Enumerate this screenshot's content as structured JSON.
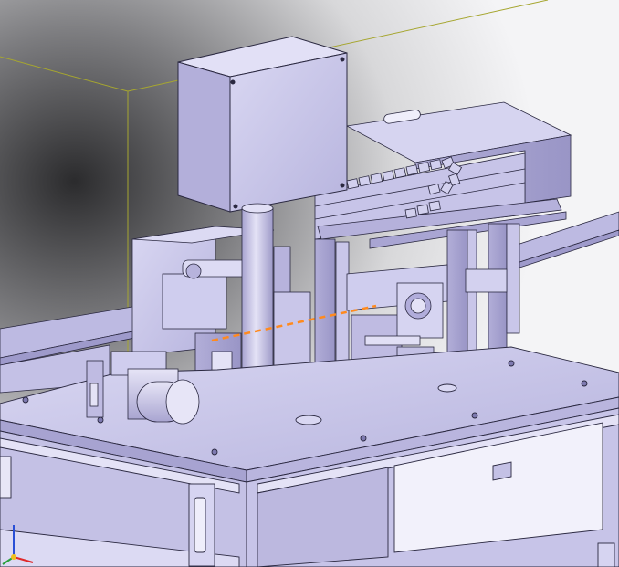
{
  "viewport": {
    "background_colors": [
      "#f4f4f6",
      "#8a8a8c",
      "#2b2b2d"
    ],
    "model_face_color": "#c9c7e8",
    "model_shadow_color": "#a9a6d2",
    "model_edge_color": "#2a2840",
    "bounding_box_color": "#a6a630",
    "sketch_line_color": "#ff8a1e"
  },
  "triad": {
    "axes": [
      {
        "name": "x",
        "color": "#e0282a"
      },
      {
        "name": "y",
        "color": "#28a03a"
      },
      {
        "name": "z",
        "color": "#2a4fd6"
      }
    ]
  }
}
